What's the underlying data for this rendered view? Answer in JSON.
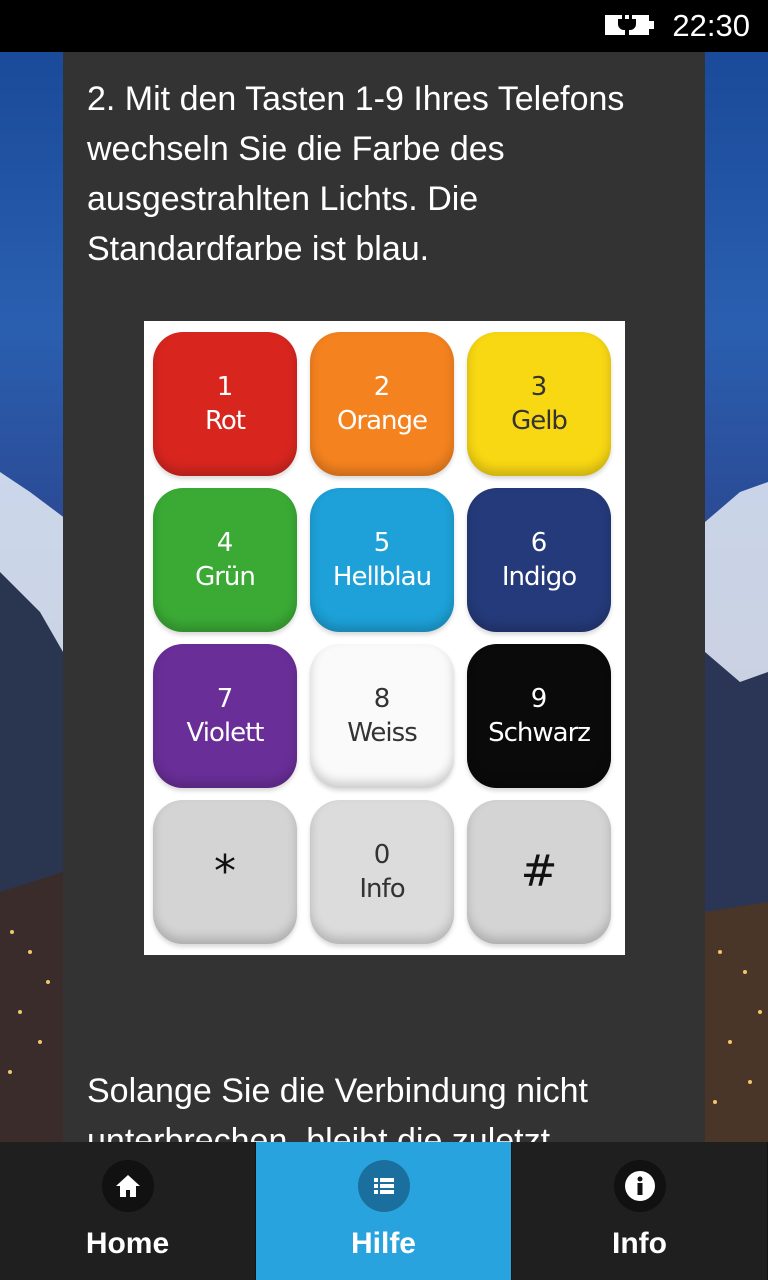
{
  "status_bar": {
    "time": "22:30"
  },
  "content": {
    "intro_text": "2. Mit den Tasten 1-9 Ihres Telefons wechseln Sie die Farbe des ausgestrahlten Lichts. Die Standardfarbe ist blau.",
    "outro_text": "Solange Sie die Verbindung nicht unterbrechen, bleibt die zuletzt"
  },
  "keypad": {
    "keys": [
      {
        "num": "1",
        "label": "Rot",
        "color": "#d8261f",
        "text_color": "#ffffff"
      },
      {
        "num": "2",
        "label": "Orange",
        "color": "#f4821f",
        "text_color": "#ffffff"
      },
      {
        "num": "3",
        "label": "Gelb",
        "color": "#f8d713",
        "text_color": "#333333"
      },
      {
        "num": "4",
        "label": "Grün",
        "color": "#3aaa35",
        "text_color": "#ffffff"
      },
      {
        "num": "5",
        "label": "Hellblau",
        "color": "#1da1d8",
        "text_color": "#ffffff"
      },
      {
        "num": "6",
        "label": "Indigo",
        "color": "#253a7a",
        "text_color": "#ffffff"
      },
      {
        "num": "7",
        "label": "Violett",
        "color": "#6a2e98",
        "text_color": "#ffffff"
      },
      {
        "num": "8",
        "label": "Weiss",
        "color": "#fafafa",
        "text_color": "#333333"
      },
      {
        "num": "9",
        "label": "Schwarz",
        "color": "#0a0a0a",
        "text_color": "#ffffff"
      },
      {
        "num": "*",
        "label": "",
        "color": "#d4d4d4",
        "text_color": "#111111"
      },
      {
        "num": "0",
        "label": "Info",
        "color": "#dcdcdc",
        "text_color": "#333333"
      },
      {
        "num": "#",
        "label": "",
        "color": "#d4d4d4",
        "text_color": "#111111"
      }
    ]
  },
  "nav": {
    "items": [
      {
        "label": "Home",
        "icon": "home-icon"
      },
      {
        "label": "Hilfe",
        "icon": "list-icon"
      },
      {
        "label": "Info",
        "icon": "info-icon"
      }
    ],
    "active_index": 1,
    "accent": "#29a3dd"
  }
}
